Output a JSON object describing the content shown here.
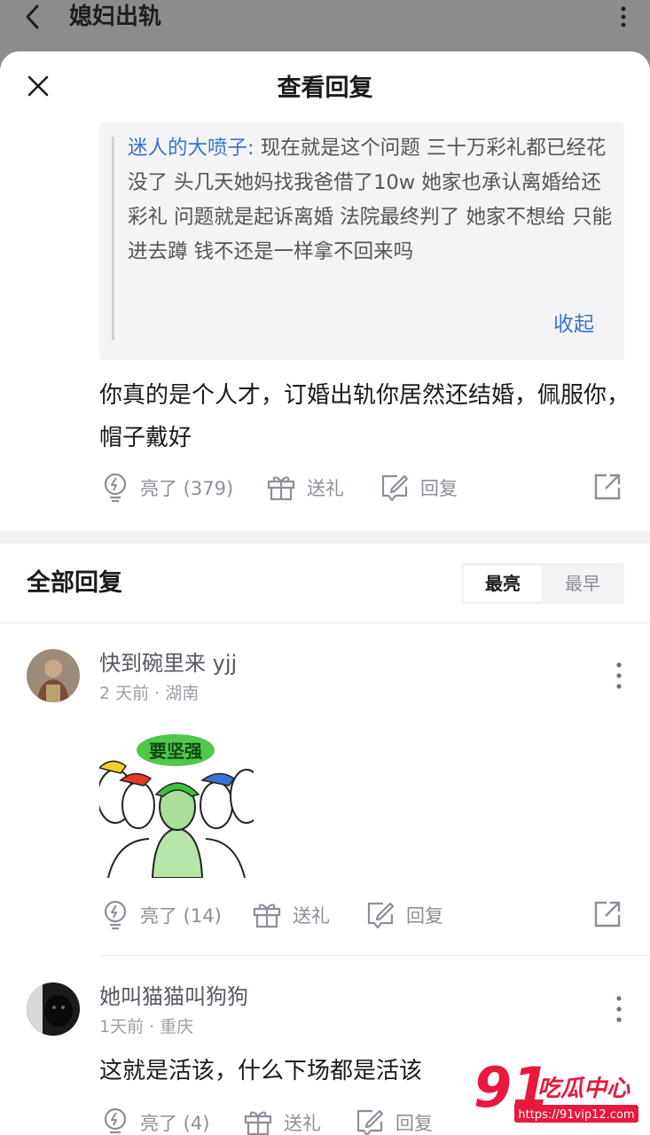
{
  "background_page": {
    "title": "媳妇出轨"
  },
  "sheet": {
    "title": "查看回复",
    "quote": {
      "author": "迷人的大喷子:",
      "text": " 现在就是这个问题 三十万彩礼都已经花没了 头几天她妈找我爸借了10w 她家也承认离婚给还彩礼 问题就是起诉离婚 法院最终判了 她家不想给 只能进去蹲 钱不还是一样拿不回来吗",
      "collapse_label": "收起"
    },
    "main_comment": {
      "text": "你真的是个人才，订婚出轨你居然还结婚，佩服你，帽子戴好",
      "like_label": "亮了 (379)",
      "gift_label": "送礼",
      "reply_label": "回复"
    }
  },
  "replies_section": {
    "title": "全部回复",
    "sort_tabs": [
      "最亮",
      "最早"
    ],
    "active_sort": "最亮"
  },
  "replies": [
    {
      "username": "快到碗里来 yjj",
      "meta": "2 天前 · 湖南",
      "meme_text": "要坚强",
      "like_label": "亮了 (14)",
      "gift_label": "送礼",
      "reply_label": "回复"
    },
    {
      "username": "她叫猫猫叫狗狗",
      "meta": "1天前 · 重庆",
      "text": "这就是活该，什么下场都是活该",
      "like_label": "亮了 (4)",
      "gift_label": "送礼",
      "reply_label": "回复"
    }
  ],
  "watermark": {
    "logo": "91吃瓜中心",
    "url": "https://91vip12.com"
  },
  "colors": {
    "link_blue": "#3b73c9",
    "muted_gray": "#8a8f99",
    "watermark_red": "#e8193c"
  }
}
